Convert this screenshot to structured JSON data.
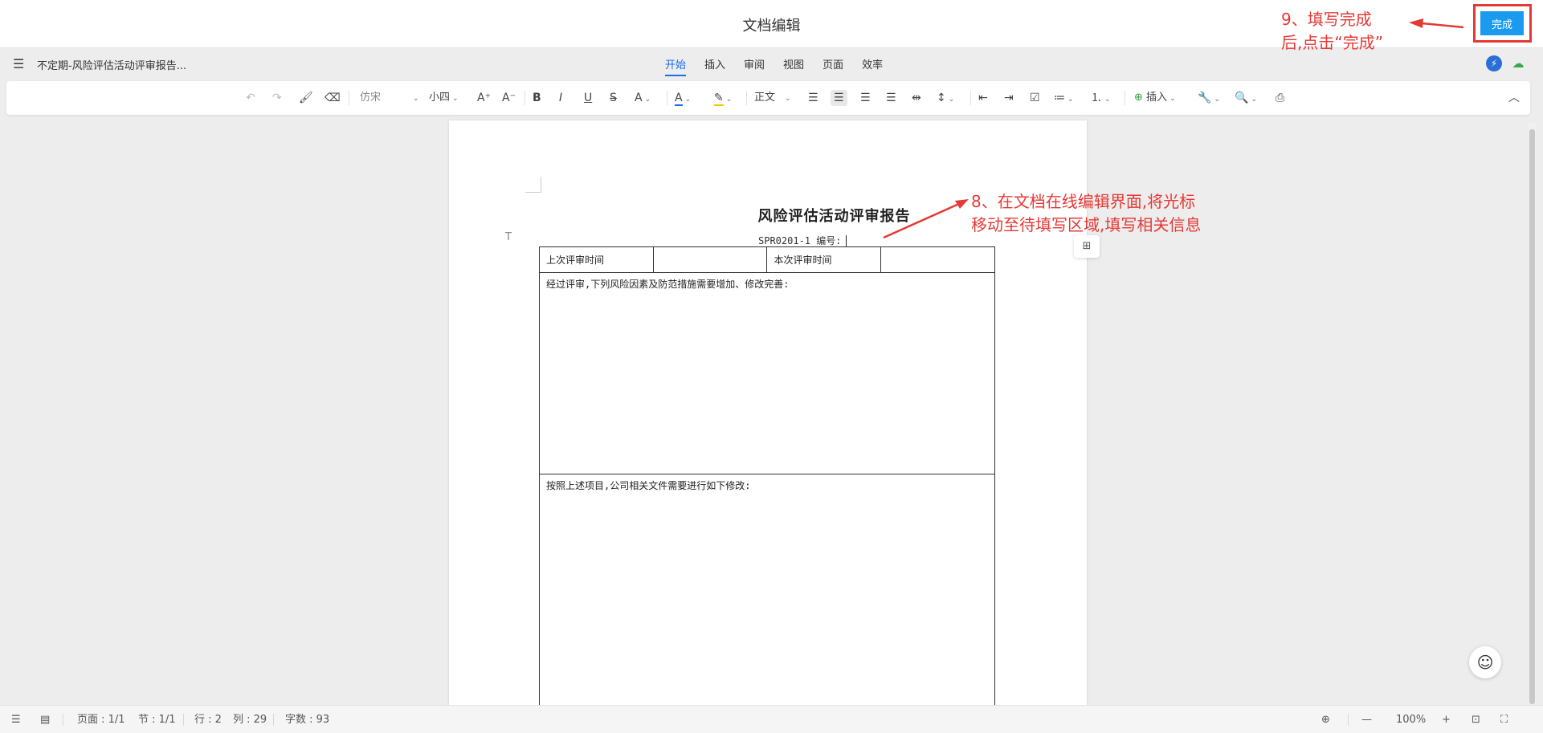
{
  "window": {
    "title": "文档编辑"
  },
  "done_button": {
    "label": "完成"
  },
  "menubar": {
    "doc_name": "不定期-风险评估活动评审报告...",
    "tabs": [
      {
        "label": "开始",
        "active": true
      },
      {
        "label": "插入"
      },
      {
        "label": "审阅"
      },
      {
        "label": "视图"
      },
      {
        "label": "页面"
      },
      {
        "label": "效率"
      }
    ]
  },
  "toolbar": {
    "font_family": "仿宋",
    "font_size": "小四",
    "grow_font": "A⁺",
    "shrink_font": "A⁻",
    "bold": "B",
    "italic": "I",
    "underline": "U",
    "strike": "S̶",
    "superscript": "A",
    "font_color": "A",
    "paragraph_style": "正文",
    "insert_label": "插入"
  },
  "document": {
    "title": "风险评估活动评审报告",
    "code": "SPR0201-1   编号:",
    "table": {
      "row1": [
        "上次评审时间",
        "",
        "本次评审时间",
        ""
      ],
      "row2": "经过评审,下列风险因素及防范措施需要增加、修改完善:",
      "row3": "按照上述项目,公司相关文件需要进行如下修改:"
    }
  },
  "annotations": {
    "step8_line1": "8、在文档在线编辑界面,将光标",
    "step8_line2": "移动至待填写区域,填写相关信息",
    "step9_line1": "9、填写完成",
    "step9_line2": "后,点击“完成”"
  },
  "statusbar": {
    "page": "页面 : 1/1",
    "section": "节 : 1/1",
    "row": "行 : 2",
    "col": "列 : 29",
    "word_count": "字数 : 93",
    "zoom": "100%"
  },
  "colors": {
    "accent": "#1a6cf0",
    "done_button": "#1a9bf0",
    "annotation": "#e53935"
  }
}
